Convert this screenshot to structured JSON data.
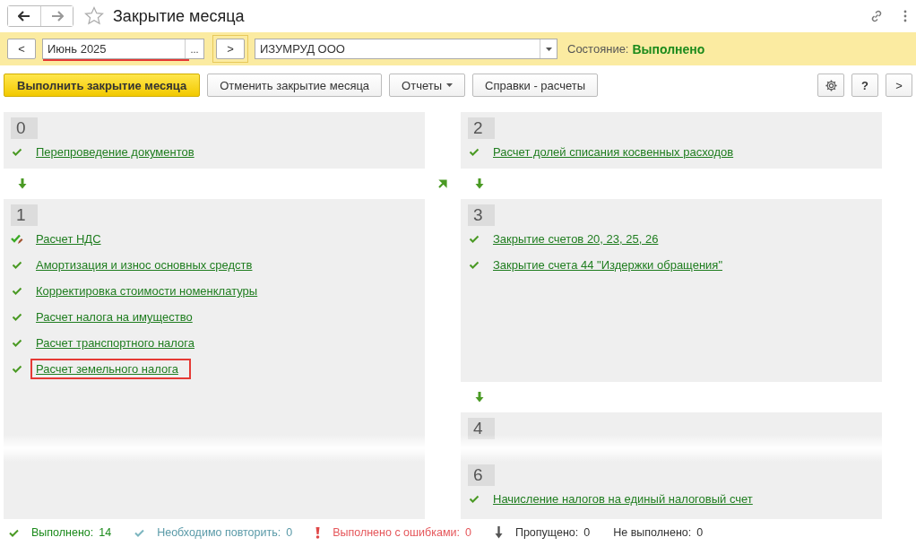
{
  "window": {
    "title": "Закрытие месяца"
  },
  "period_bar": {
    "prev": "<",
    "period": "Июнь 2025",
    "period_underlined": true,
    "select": "...",
    "next": ">",
    "organization": "ИЗУМРУД ООО",
    "state_label": "Состояние:",
    "state_value": "Выполнено"
  },
  "toolbar": {
    "run": "Выполнить закрытие месяца",
    "cancel": "Отменить закрытие месяца",
    "reports": "Отчеты",
    "references": "Справки - расчеты",
    "help": "?",
    "more": ">"
  },
  "columns": [
    {
      "entries": [
        {
          "kind": "stage",
          "number": "0",
          "items": [
            {
              "label": "Перепроведение документов",
              "kind": "done",
              "highlighted": false
            }
          ]
        },
        {
          "kind": "arrow"
        },
        {
          "kind": "stage",
          "number": "1",
          "items": [
            {
              "label": "Расчет НДС",
              "kind": "edited",
              "highlighted": false
            },
            {
              "label": "Амортизация и износ основных средств",
              "kind": "done",
              "highlighted": false
            },
            {
              "label": "Корректировка стоимости номенклатуры",
              "kind": "done",
              "highlighted": false
            },
            {
              "label": "Расчет налога на имущество",
              "kind": "done",
              "highlighted": false
            },
            {
              "label": "Расчет транспортного налога",
              "kind": "done",
              "highlighted": false
            },
            {
              "label": "Расчет земельного налога",
              "kind": "done",
              "highlighted": true
            }
          ]
        }
      ]
    },
    {
      "entries": [
        {
          "kind": "stage",
          "number": "2",
          "items": [
            {
              "label": "Расчет долей списания косвенных расходов",
              "kind": "done",
              "highlighted": false
            }
          ]
        },
        {
          "kind": "arrow"
        },
        {
          "kind": "stage",
          "number": "3",
          "items": [
            {
              "label": "Закрытие счетов 20, 23, 25, 26",
              "kind": "done",
              "highlighted": false
            },
            {
              "label": "Закрытие счета 44 \"Издержки обращения\"",
              "kind": "done",
              "highlighted": false
            }
          ]
        },
        {
          "kind": "arrow"
        },
        {
          "kind": "stage",
          "number": "4"
        },
        {
          "kind": "stage",
          "number": "6",
          "items": [
            {
              "label": "Начисление налогов на единый налоговый счет",
              "kind": "done",
              "highlighted": false
            }
          ]
        }
      ]
    }
  ],
  "status_bar": [
    {
      "kind": "done",
      "label": "Выполнено:",
      "count": "14"
    },
    {
      "kind": "repeat",
      "label": "Необходимо повторить:",
      "count": "0"
    },
    {
      "kind": "error",
      "label": "Выполнено с ошибками:",
      "count": "0"
    },
    {
      "kind": "skipped",
      "label": "Пропущено:",
      "count": "0"
    },
    {
      "kind": "notdone",
      "label": "Не выполнено:",
      "count": "0"
    }
  ]
}
